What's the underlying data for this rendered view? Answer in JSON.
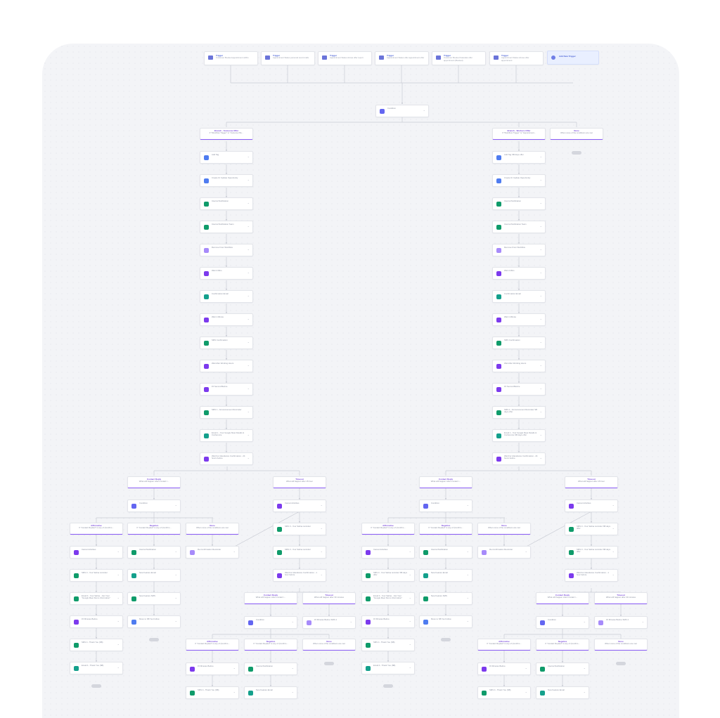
{
  "triggers": [
    {
      "title": "Trigger",
      "desc": "Customer Booked appointment within"
    },
    {
      "title": "Trigger",
      "desc": "Appointment Status personal record calls"
    },
    {
      "title": "Trigger",
      "desc": "Appointment Status shows offer report"
    },
    {
      "title": "Trigger",
      "desc": "Appointment Status offer appointment offer"
    },
    {
      "title": "Trigger",
      "desc": "Customer Booked Calendar offer appointment (Booked)"
    },
    {
      "title": "Trigger",
      "desc": "Appointment Status shows offer appointment"
    }
  ],
  "add_trigger_label": "Add New Trigger",
  "condition_label": "Condition",
  "left_branch": {
    "title": "Branch - Someone Offer",
    "desc": "If \"Workflow Trigger\" is \"Customer Bo..."
  },
  "right_branch": {
    "title": "Branch - Workers Offer",
    "desc": "If \"Workflow Trigger\" is \"Appointment..."
  },
  "none_branch": {
    "title": "None",
    "desc": "When none of the conditions are met"
  },
  "left_actions": [
    {
      "label": "Add Tag",
      "color": "blue"
    },
    {
      "label": "Create Or Update Opportunity",
      "color": "blue"
    },
    {
      "label": "Internal Notification",
      "color": "green"
    },
    {
      "label": "Internal Notification Team",
      "color": "green"
    },
    {
      "label": "Remove From Workflow",
      "color": "lilac"
    },
    {
      "label": "Wait 4 Mins",
      "color": "purple"
    },
    {
      "label": "Confirmation Email",
      "color": "teal"
    },
    {
      "label": "Wait 1 Minute",
      "color": "purple"
    },
    {
      "label": "SMS Confirmation",
      "color": "green"
    },
    {
      "label": "Wait After Working Hours",
      "color": "purple"
    },
    {
      "label": "15 Second Before",
      "color": "purple"
    },
    {
      "label": "SMS 1 - Announcement Reminder",
      "color": "green"
    },
    {
      "label": "Email 1 - Your Google Meet Details & Conference",
      "color": "teal"
    },
    {
      "label": "Wait For Attendance Confirmation - 24 hours before",
      "color": "purple"
    }
  ],
  "right_actions": [
    {
      "label": "Add Tag SB days offer",
      "color": "blue"
    },
    {
      "label": "Create Or Update Opportunity",
      "color": "blue"
    },
    {
      "label": "Internal Notification",
      "color": "green"
    },
    {
      "label": "Internal Notification Team",
      "color": "green"
    },
    {
      "label": "Remove From Workflow",
      "color": "lilac"
    },
    {
      "label": "Wait 4 Mins",
      "color": "purple"
    },
    {
      "label": "Confirmation Email",
      "color": "teal"
    },
    {
      "label": "Wait 1 Minute",
      "color": "purple"
    },
    {
      "label": "SMS Confirmation",
      "color": "green"
    },
    {
      "label": "Wait After Working Hours",
      "color": "purple"
    },
    {
      "label": "15 Second Before",
      "color": "purple"
    },
    {
      "label": "SMS 1 - Announcement Reminder SB days offer",
      "color": "green"
    },
    {
      "label": "Email 1 - Your Google Meet Details & Conference SB days offer",
      "color": "teal"
    },
    {
      "label": "Wait For Attendance Confirmation - 24 hours before",
      "color": "purple"
    }
  ],
  "contact_reply": {
    "title": "Contact Reply",
    "desc": "What will happen when contact r..."
  },
  "timeout": {
    "title": "Timeout",
    "desc": "What will happen after 15 hour"
  },
  "timeout_short": {
    "title": "Timeout",
    "desc": "What will happen after 30 minutes"
  },
  "affirmative": {
    "title": "Affirmative",
    "desc": "If \"Contact Replied\" is any of (Confirm..."
  },
  "negative": {
    "title": "Negative",
    "desc": "If \"Contact Replied\" is any of (Confirm..."
  },
  "none_small": {
    "title": "None",
    "desc": "When none of the conditions are met"
  },
  "sub_actions": {
    "cancel": "Cancel Activities",
    "sms_rem": "SMS 3 - Your Salina reminder",
    "sms_late": "SMS 3 - Your Salina reminder SB days offer",
    "email_meet": "Email 3 - Your Salina - Join Your \"Google Meet Demo Information\"",
    "wait_conf": "Wait For Attendance Confirmation - 1 hour before",
    "int": "Internal Notification",
    "new_email": "New Feature Email",
    "new_sms": "New Feature SMS",
    "move": "Move to SB Yes Follow",
    "reconf": "Re-Confirmation Reminder",
    "fifteen": "15 Minutes Before",
    "sms_ty": "SMS 4 - Thank You (SB)",
    "email_ty": "Email 4 - Thank You (SB)",
    "fifteen_sms": "15 Minutes Before SMS 4"
  },
  "end_label": "END",
  "badges": {
    "a": "+",
    "b": "+"
  }
}
